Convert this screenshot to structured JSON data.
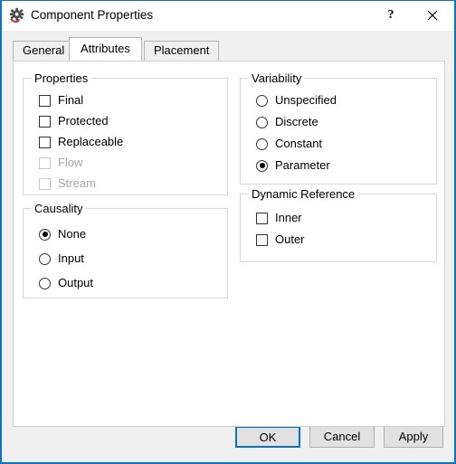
{
  "window": {
    "title": "Component Properties",
    "icon": "gear-refresh-icon",
    "accent_color": "#0a74c4",
    "background": "#f0f0f0"
  },
  "titlebar_buttons": [
    {
      "name": "help",
      "glyph": "?"
    },
    {
      "name": "close",
      "glyph": "✕"
    }
  ],
  "tabs": [
    {
      "label": "General",
      "active": false
    },
    {
      "label": "Attributes",
      "active": true
    },
    {
      "label": "Placement",
      "active": false
    }
  ],
  "groups": {
    "properties": {
      "title": "Properties",
      "type": "checkbox",
      "items": [
        {
          "label": "Final",
          "checked": false,
          "enabled": true
        },
        {
          "label": "Protected",
          "checked": false,
          "enabled": true
        },
        {
          "label": "Replaceable",
          "checked": false,
          "enabled": true
        },
        {
          "label": "Flow",
          "checked": false,
          "enabled": false
        },
        {
          "label": "Stream",
          "checked": false,
          "enabled": false
        }
      ]
    },
    "causality": {
      "title": "Causality",
      "type": "radio",
      "selected": "None",
      "items": [
        {
          "label": "None",
          "selected": true,
          "enabled": true
        },
        {
          "label": "Input",
          "selected": false,
          "enabled": true
        },
        {
          "label": "Output",
          "selected": false,
          "enabled": true
        }
      ]
    },
    "variability": {
      "title": "Variability",
      "type": "radio",
      "selected": "Parameter",
      "items": [
        {
          "label": "Unspecified",
          "selected": false,
          "enabled": true
        },
        {
          "label": "Discrete",
          "selected": false,
          "enabled": true
        },
        {
          "label": "Constant",
          "selected": false,
          "enabled": true
        },
        {
          "label": "Parameter",
          "selected": true,
          "enabled": true
        }
      ]
    },
    "dynamic_reference": {
      "title": "Dynamic Reference",
      "type": "checkbox",
      "items": [
        {
          "label": "Inner",
          "checked": false,
          "enabled": true
        },
        {
          "label": "Outer",
          "checked": false,
          "enabled": true
        }
      ]
    }
  },
  "buttons": {
    "ok": "OK",
    "cancel": "Cancel",
    "apply": "Apply"
  }
}
